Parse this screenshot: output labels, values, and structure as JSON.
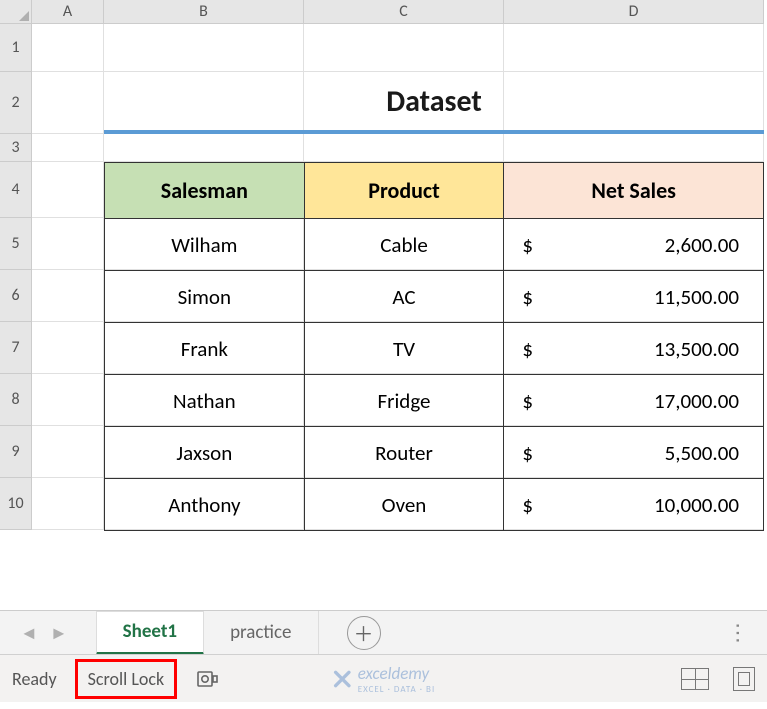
{
  "columns": [
    "A",
    "B",
    "C",
    "D"
  ],
  "rows": [
    "1",
    "2",
    "3",
    "4",
    "5",
    "6",
    "7",
    "8",
    "9",
    "10"
  ],
  "title": "Dataset",
  "headers": {
    "salesman": "Salesman",
    "product": "Product",
    "netsales": "Net Sales"
  },
  "currency_symbol": "$",
  "data": [
    {
      "salesman": "Wilham",
      "product": "Cable",
      "netsales": "2,600.00"
    },
    {
      "salesman": "Simon",
      "product": "AC",
      "netsales": "11,500.00"
    },
    {
      "salesman": "Frank",
      "product": "TV",
      "netsales": "13,500.00"
    },
    {
      "salesman": "Nathan",
      "product": "Fridge",
      "netsales": "17,000.00"
    },
    {
      "salesman": "Jaxson",
      "product": "Router",
      "netsales": "5,500.00"
    },
    {
      "salesman": "Anthony",
      "product": "Oven",
      "netsales": "10,000.00"
    }
  ],
  "tabs": {
    "active": "Sheet1",
    "others": [
      "practice"
    ]
  },
  "status": {
    "ready": "Ready",
    "scroll_lock": "Scroll Lock"
  },
  "watermark": {
    "brand": "exceldemy",
    "sub": "EXCEL · DATA · BI"
  },
  "chart_data": {
    "type": "table",
    "title": "Dataset",
    "columns": [
      "Salesman",
      "Product",
      "Net Sales"
    ],
    "rows": [
      [
        "Wilham",
        "Cable",
        2600.0
      ],
      [
        "Simon",
        "AC",
        11500.0
      ],
      [
        "Frank",
        "TV",
        13500.0
      ],
      [
        "Nathan",
        "Fridge",
        17000.0
      ],
      [
        "Jaxson",
        "Router",
        5500.0
      ],
      [
        "Anthony",
        "Oven",
        10000.0
      ]
    ]
  }
}
